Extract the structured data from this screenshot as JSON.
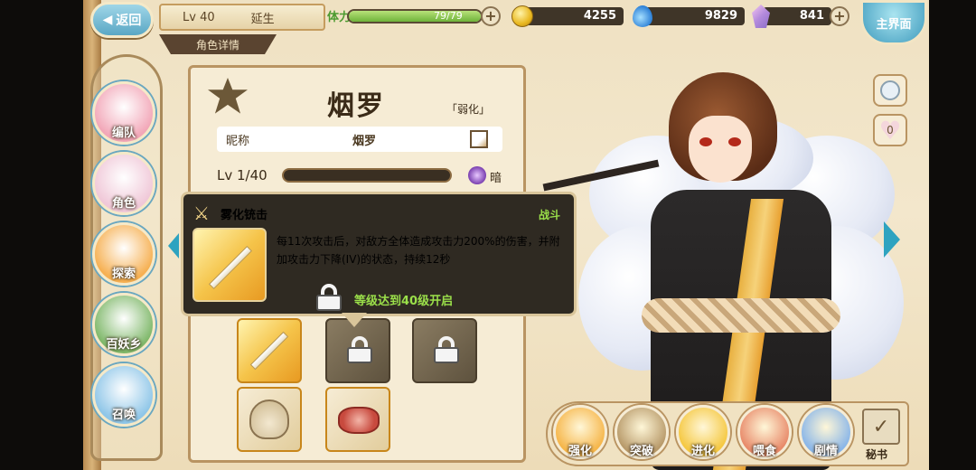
{
  "header": {
    "back_label": "返回",
    "level": "Lv 40",
    "player_name": "延生",
    "screen_title": "角色详情",
    "stamina_label": "体力",
    "stamina_text": "79/79",
    "stamina_fraction": 1.0,
    "coins": "4255",
    "water": "9829",
    "gems": "841",
    "home_label": "主界面"
  },
  "sidebar": {
    "items": [
      {
        "label": "编队",
        "color": "#f2a7b8"
      },
      {
        "label": "角色",
        "color": "#f0c8d8"
      },
      {
        "label": "探索",
        "color": "#f6b052"
      },
      {
        "label": "百妖乡",
        "color": "#7fb86a"
      },
      {
        "label": "召唤",
        "color": "#8fc6e8"
      }
    ]
  },
  "character": {
    "name": "烟罗",
    "status": "「弱化」",
    "nickname_label": "昵称",
    "nickname": "烟罗",
    "level_label": "Lv  1/40",
    "attribute": "暗"
  },
  "tooltip": {
    "title": "雾化铳击",
    "type": "战斗",
    "description": "每11次攻击后，对敌方全体造成攻击力200%的伤害，并附加攻击力下降(IV)的状态，持续12秒",
    "unlock_note": "等级达到40级开启"
  },
  "right_buttons": {
    "heart_count": "0"
  },
  "bottom_bar": {
    "buttons": [
      {
        "label": "强化",
        "color": "#f6b64a"
      },
      {
        "label": "突破",
        "color": "#b89a6a"
      },
      {
        "label": "进化",
        "color": "#f5c842"
      },
      {
        "label": "喂食",
        "color": "#e88a6a"
      },
      {
        "label": "剧情",
        "color": "#8ab6e8"
      }
    ],
    "secretary_label": "秘书"
  },
  "colors": {
    "accent": "#2ea3c0",
    "green_text": "#9be04a",
    "panel_bg": "#f6ecd5"
  }
}
